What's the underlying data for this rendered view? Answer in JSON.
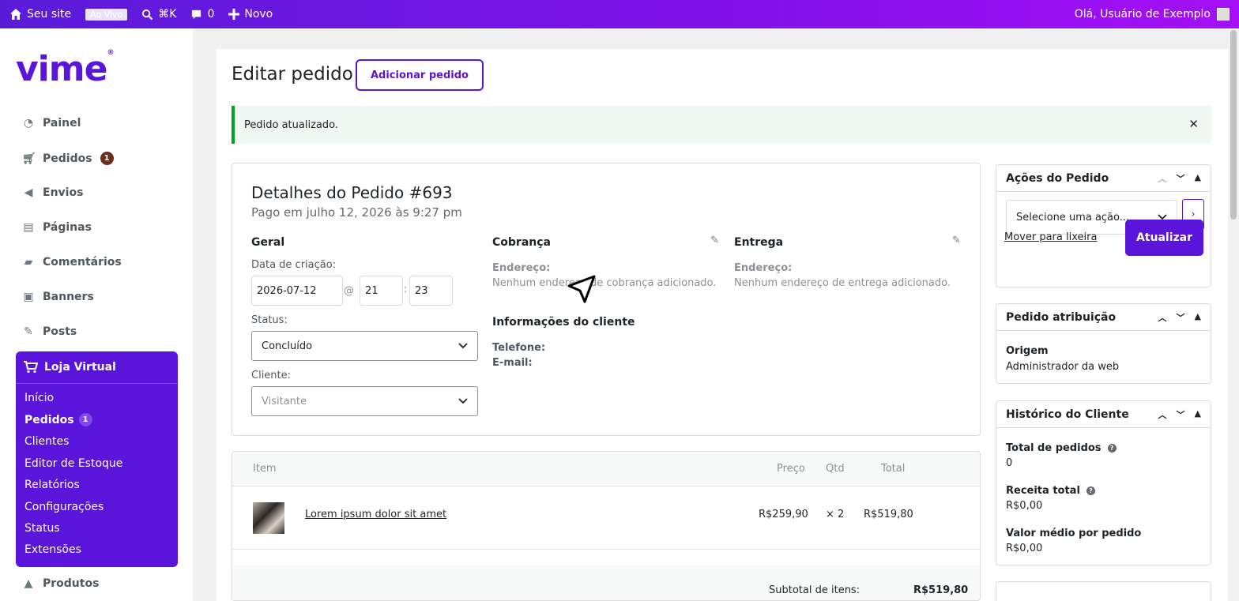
{
  "adminbar": {
    "site_name": "Seu site",
    "live_badge": "Ao Vivo",
    "search_shortcut": "⌘K",
    "comments_count": "0",
    "new_label": "Novo",
    "greeting": "Olá, Usuário de Exemplo"
  },
  "sidebar": {
    "logo": "vime",
    "items": [
      {
        "label": "Painel",
        "icon": "dashboard-icon"
      },
      {
        "label": "Pedidos",
        "icon": "cart-icon",
        "badge": "1"
      },
      {
        "label": "Envios",
        "icon": "megaphone-icon"
      },
      {
        "label": "Páginas",
        "icon": "pages-icon"
      },
      {
        "label": "Comentários",
        "icon": "comment-icon"
      },
      {
        "label": "Banners",
        "icon": "image-icon"
      },
      {
        "label": "Posts",
        "icon": "pin-icon"
      }
    ],
    "store": {
      "title": "Loja Virtual",
      "subitems": [
        "Início",
        "Pedidos",
        "Clientes",
        "Editor de Estoque",
        "Relatórios",
        "Configurações",
        "Status",
        "Extensões"
      ],
      "pedidos_badge": "1"
    },
    "products_label": "Produtos"
  },
  "page": {
    "title": "Editar pedido",
    "add_button": "Adicionar pedido",
    "notice": "Pedido atualizado."
  },
  "order": {
    "title": "Detalhes do Pedido #693",
    "paid_on": "Pago em julho 12, 2026 às 9:27 pm",
    "general": {
      "heading": "Geral",
      "date_label": "Data de criação:",
      "date_value": "2026-07-12",
      "at": "@",
      "hour": "21",
      "colon": ":",
      "minute": "23",
      "status_label": "Status:",
      "status_value": "Concluído",
      "customer_label": "Cliente:",
      "customer_value": "Visitante"
    },
    "billing": {
      "heading": "Cobrança",
      "address_label": "Endereço:",
      "address_value": "Nenhum endereço de cobrança adicionado."
    },
    "shipping": {
      "heading": "Entrega",
      "address_label": "Endereço:",
      "address_value": "Nenhum endereço de entrega adicionado."
    },
    "customer_info": {
      "heading": "Informações do cliente",
      "phone_label": "Telefone:",
      "email_label": "E-mail:"
    }
  },
  "items": {
    "headers": {
      "item": "Item",
      "price": "Preço",
      "qty": "Qtd",
      "total": "Total"
    },
    "rows": [
      {
        "name": "Lorem ipsum dolor sit amet",
        "price": "R$259,90",
        "qty": "× 2",
        "total": "R$519,80"
      }
    ],
    "subtotal_label": "Subtotal de itens:",
    "subtotal_value": "R$519,80"
  },
  "actions_box": {
    "title": "Ações do Pedido",
    "select_placeholder": "Selecione uma ação...",
    "trash_link": "Mover para lixeira",
    "update_button": "Atualizar"
  },
  "attribution_box": {
    "title": "Pedido atribuição",
    "origin_label": "Origem",
    "origin_value": "Administrador da web"
  },
  "history_box": {
    "title": "Histórico do Cliente",
    "total_orders_label": "Total de pedidos",
    "total_orders_value": "0",
    "revenue_label": "Receita total",
    "revenue_value": "R$0,00",
    "avg_label": "Valor médio por pedido",
    "avg_value": "R$0,00"
  },
  "colors": {
    "brand": "#5b14d9",
    "adminbar_start": "#5a1bd8",
    "adminbar_end": "#a40ff5",
    "notice_border": "#00a32a"
  }
}
